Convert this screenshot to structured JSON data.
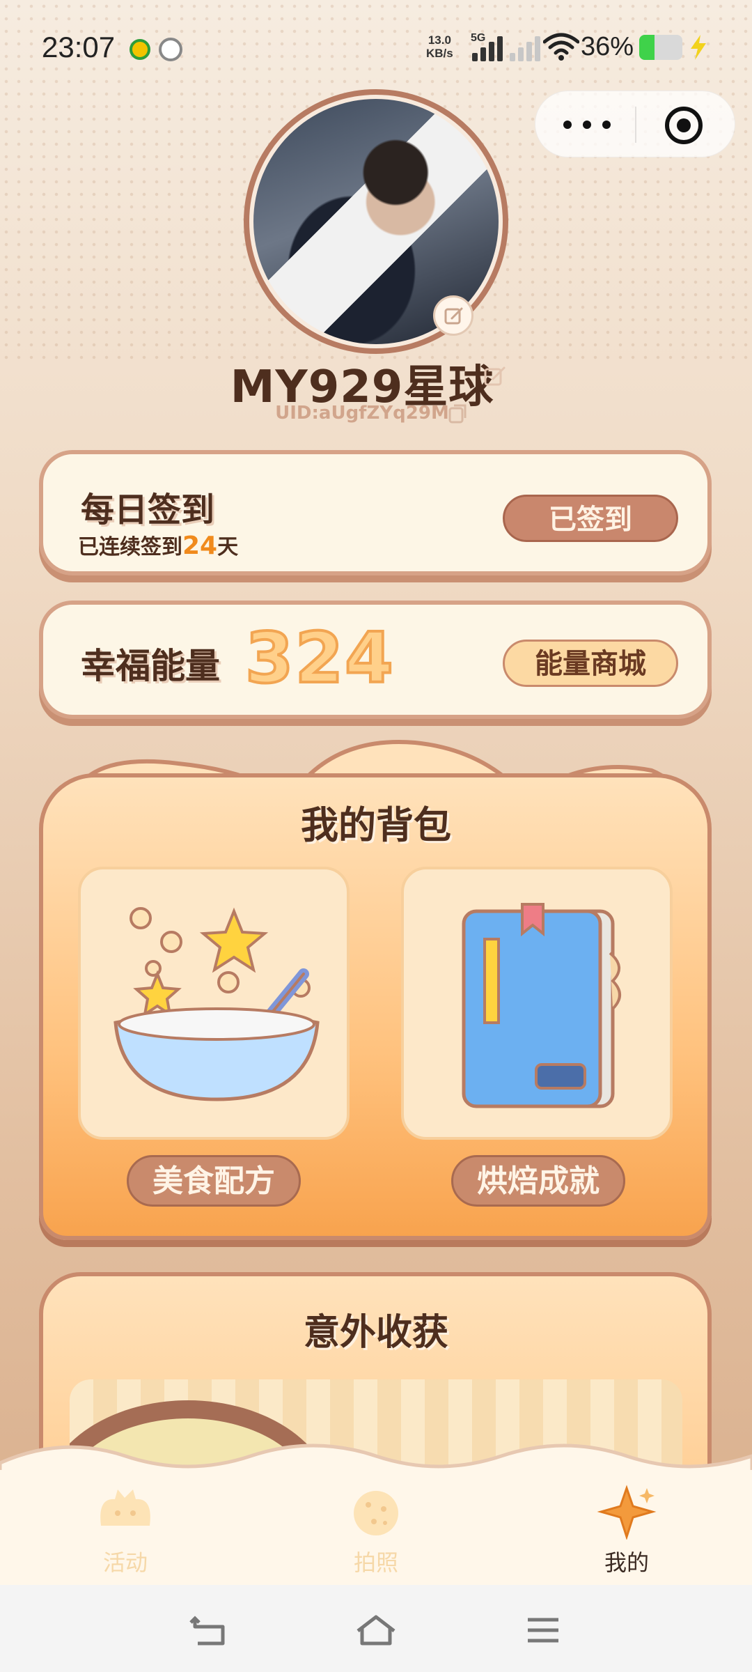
{
  "status_bar": {
    "time": "23:07",
    "net_speed_value": "13.0",
    "net_speed_unit": "KB/s",
    "network": "5G",
    "battery_percent": "36%",
    "battery_level": 0.36
  },
  "profile": {
    "username": "MY929星球",
    "uid": "UID:aUgfZYq29M"
  },
  "checkin": {
    "title": "每日签到",
    "sub_prefix": "已连续签到",
    "days": "24",
    "sub_suffix": "天",
    "button_label": "已签到"
  },
  "energy": {
    "title": "幸福能量",
    "value": "324",
    "button_label": "能量商城"
  },
  "backpack": {
    "title": "我的背包",
    "items": [
      {
        "label": "美食配方",
        "icon": "mixing-bowl-icon"
      },
      {
        "label": "烘焙成就",
        "icon": "book-icon"
      }
    ]
  },
  "surprise": {
    "title": "意外收获"
  },
  "tabbar": {
    "tabs": [
      {
        "label": "活动",
        "icon": "bread-cat-icon",
        "active": false
      },
      {
        "label": "拍照",
        "icon": "cookie-icon",
        "active": false
      },
      {
        "label": "我的",
        "icon": "star-icon",
        "active": true
      }
    ]
  },
  "colors": {
    "accent_orange": "#f08a1c",
    "brown_text": "#4e2e1e",
    "button_brown": "#c9876d",
    "card_bg": "#fdf6e6"
  }
}
